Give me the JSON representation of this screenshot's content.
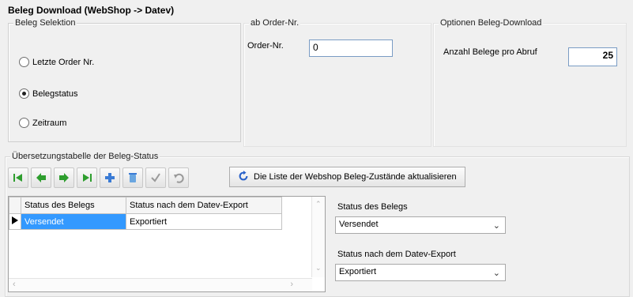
{
  "window": {
    "title": "Beleg Download (WebShop -> Datev)"
  },
  "selection": {
    "title": "Beleg Selektion",
    "options": [
      {
        "label": "Letzte Order Nr.",
        "selected": false
      },
      {
        "label": "Belegstatus",
        "selected": true
      },
      {
        "label": "Zeitraum",
        "selected": false
      }
    ]
  },
  "order": {
    "title": "ab Order-Nr.",
    "label": "Order-Nr.",
    "value": "0"
  },
  "options": {
    "title": "Optionen Beleg-Download",
    "count_label": "Anzahl Belege pro Abruf",
    "count_value": "25"
  },
  "translation": {
    "title": "Übersetzungstabelle der Beleg-Status",
    "toolbar": {
      "icons": [
        "first-icon",
        "prev-icon",
        "next-icon",
        "last-icon",
        "add-icon",
        "delete-icon",
        "check-icon",
        "undo-icon"
      ],
      "refresh_label": "Die Liste der Webshop Beleg-Zustände aktualisieren"
    },
    "table": {
      "headers": [
        "Status des Belegs",
        "Status nach dem Datev-Export"
      ],
      "rows": [
        [
          "Versendet",
          "Exportiert"
        ]
      ]
    },
    "detail": {
      "status_label": "Status des Belegs",
      "status_value": "Versendet",
      "export_label": "Status nach dem Datev-Export",
      "export_value": "Exportiert"
    }
  },
  "colors": {
    "accent": "#3399ff",
    "nav_green": "#2e9e2e"
  }
}
